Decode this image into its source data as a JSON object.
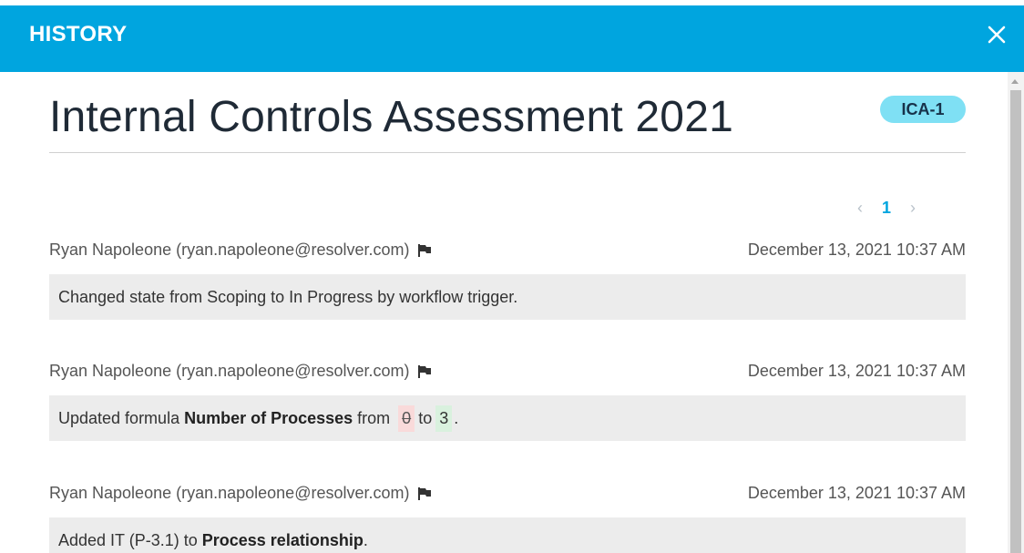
{
  "dialog": {
    "title": "HISTORY",
    "close_icon": "close-icon",
    "accent_color": "#00a5df"
  },
  "record": {
    "title": "Internal Controls Assessment 2021",
    "id_badge": "ICA-1",
    "badge_color": "#7fe0f4"
  },
  "pagination": {
    "prev": "‹",
    "current": "1",
    "next": "›"
  },
  "history": [
    {
      "author": "Ryan Napoleone (ryan.napoleone@resolver.com)",
      "flag_icon": "flag-icon",
      "timestamp": "December 13, 2021 10:37 AM",
      "message": "Changed state from Scoping to In Progress by workflow trigger."
    },
    {
      "author": "Ryan Napoleone (ryan.napoleone@resolver.com)",
      "flag_icon": "flag-icon",
      "timestamp": "December 13, 2021 10:37 AM",
      "message_prefix": "Updated formula ",
      "field": "Number of Processes",
      "from_word": " from ",
      "old_value": "0",
      "to_word": "to",
      "new_value": "3",
      "suffix": "."
    },
    {
      "author": "Ryan Napoleone (ryan.napoleone@resolver.com)",
      "flag_icon": "flag-icon",
      "timestamp": "December 13, 2021 10:37 AM",
      "message_prefix": "Added IT (P-3.1) to ",
      "field": "Process relationship",
      "suffix": "."
    }
  ]
}
